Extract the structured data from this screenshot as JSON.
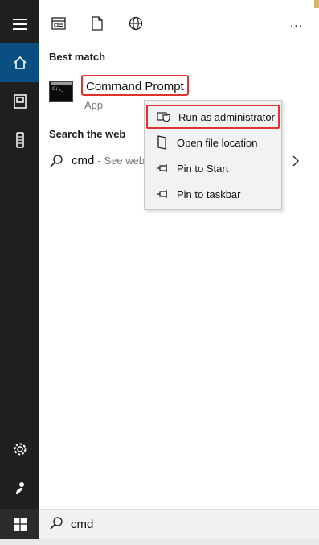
{
  "toolbar": {
    "icons": [
      "apps-icon",
      "document-icon",
      "web-icon",
      "more-icon"
    ],
    "more_label": "..."
  },
  "best_match": {
    "heading": "Best match",
    "title": "Command Prompt",
    "subtitle": "App",
    "icon_text": "C:\\_"
  },
  "web": {
    "heading": "Search the web",
    "query": "cmd",
    "hint": "- See web"
  },
  "context_menu": {
    "items": [
      {
        "label": "Run as administrator",
        "icon": "shield-icon"
      },
      {
        "label": "Open file location",
        "icon": "file-location-icon"
      },
      {
        "label": "Pin to Start",
        "icon": "pin-icon"
      },
      {
        "label": "Pin to taskbar",
        "icon": "pin-icon"
      }
    ]
  },
  "search": {
    "value": "cmd"
  },
  "colors": {
    "rail": "#1f1f1f",
    "active": "#0a4f82",
    "highlight_border": "#e0322e",
    "menu_bg": "#f2f2f2"
  }
}
